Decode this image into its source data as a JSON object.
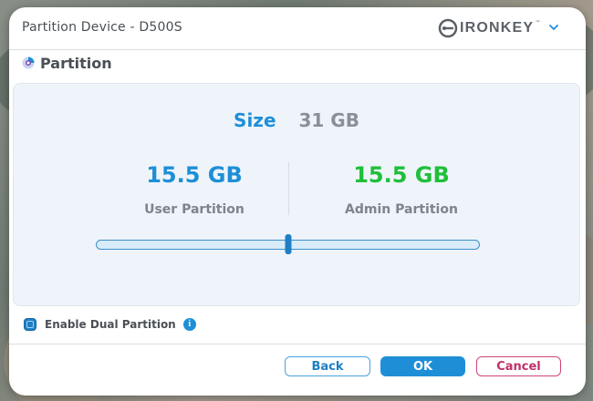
{
  "window": {
    "title": "Partition Device - D500S",
    "brand": "IRONKEY",
    "brand_tm": "™"
  },
  "section": {
    "title": "Partition"
  },
  "summary": {
    "size_label": "Size",
    "size_value": "31 GB"
  },
  "partitions": {
    "user": {
      "size": "15.5 GB",
      "label": "User Partition"
    },
    "admin": {
      "size": "15.5 GB",
      "label": "Admin Partition"
    }
  },
  "slider": {
    "value": 0.5
  },
  "options": {
    "dual_partition_label": "Enable Dual Partition",
    "dual_partition_checked": true,
    "info_glyph": "i"
  },
  "buttons": {
    "back": "Back",
    "ok": "OK",
    "cancel": "Cancel"
  },
  "colors": {
    "accent": "#1e8fd6",
    "admin_green": "#1fbf3a",
    "cancel_red": "#c0306a"
  },
  "icons": [
    "ironkey-logo-icon",
    "chevron-down-icon",
    "partition-icon",
    "info-icon"
  ]
}
